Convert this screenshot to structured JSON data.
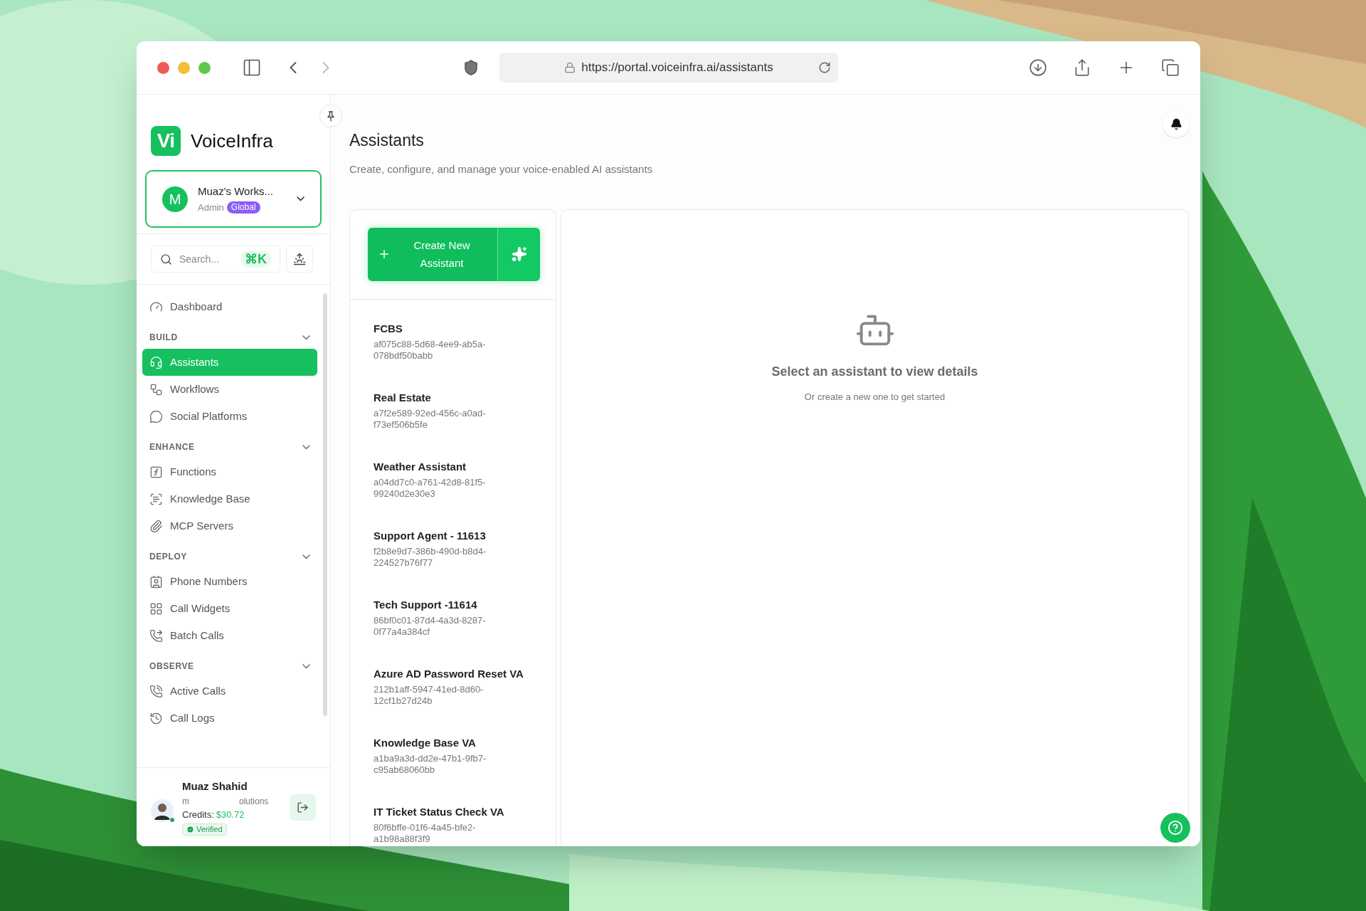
{
  "browser": {
    "url": "https://portal.voiceinfra.ai/assistants",
    "forward_disabled": true
  },
  "sidebar": {
    "brand": {
      "logo": "Vi",
      "name": "VoiceInfra"
    },
    "workspace": {
      "avatar": "M",
      "name": "Muaz's Works...",
      "role": "Admin",
      "badge": "Global"
    },
    "search": {
      "placeholder": "Search...",
      "shortcut": "⌘K"
    },
    "nav": [
      {
        "kind": "item",
        "label": "Dashboard",
        "selected": false
      },
      {
        "kind": "section",
        "label": "BUILD",
        "expanded": true,
        "items": [
          {
            "label": "Assistants",
            "selected": true
          },
          {
            "label": "Workflows",
            "selected": false
          },
          {
            "label": "Social Platforms",
            "selected": false
          }
        ]
      },
      {
        "kind": "section",
        "label": "ENHANCE",
        "expanded": true,
        "items": [
          {
            "label": "Functions",
            "selected": false
          },
          {
            "label": "Knowledge Base",
            "selected": false
          },
          {
            "label": "MCP Servers",
            "selected": false
          }
        ]
      },
      {
        "kind": "section",
        "label": "DEPLOY",
        "expanded": true,
        "items": [
          {
            "label": "Phone Numbers",
            "selected": false
          },
          {
            "label": "Call Widgets",
            "selected": false
          },
          {
            "label": "Batch Calls",
            "selected": false
          }
        ]
      },
      {
        "kind": "section",
        "label": "OBSERVE",
        "expanded": true,
        "items": [
          {
            "label": "Active Calls",
            "selected": false
          },
          {
            "label": "Call Logs",
            "selected": false
          }
        ]
      }
    ],
    "user": {
      "name": "Muaz Shahid",
      "email_start": "m",
      "email_end": "olutions",
      "credits_label": "Credits:",
      "credits": "$30.72",
      "verified": "Verified",
      "online": true
    }
  },
  "page": {
    "title": "Assistants",
    "subtitle": "Create, configure, and manage your voice-enabled AI assistants"
  },
  "create_button": "Create New Assistant",
  "assistants": [
    {
      "name": "FCBS",
      "id": "af075c88-5d68-4ee9-ab5a-078bdf50babb",
      "selected": false
    },
    {
      "name": "Real Estate",
      "id": "a7f2e589-92ed-456c-a0ad-f73ef506b5fe",
      "selected": false
    },
    {
      "name": "Weather Assistant",
      "id": "a04dd7c0-a761-42d8-81f5-99240d2e30e3",
      "selected": false
    },
    {
      "name": "Support Agent - 11613",
      "id": "f2b8e9d7-386b-490d-b8d4-224527b76f77",
      "selected": false
    },
    {
      "name": "Tech Support -11614",
      "id": "86bf0c01-87d4-4a3d-8287-0f77a4a384cf",
      "selected": false
    },
    {
      "name": "Azure AD Password Reset VA",
      "id": "212b1aff-5947-41ed-8d60-12cf1b27d24b",
      "selected": false
    },
    {
      "name": "Knowledge Base VA",
      "id": "a1ba9a3d-dd2e-47b1-9fb7-c95ab68060bb",
      "selected": false
    },
    {
      "name": "IT Ticket Status Check VA",
      "id": "80f6bffe-01f6-4a45-bfe2-a1b98a88f3f9",
      "selected": false
    }
  ],
  "empty_state": {
    "title": "Select an assistant to view details",
    "subtitle": "Or create a new one to get started"
  }
}
